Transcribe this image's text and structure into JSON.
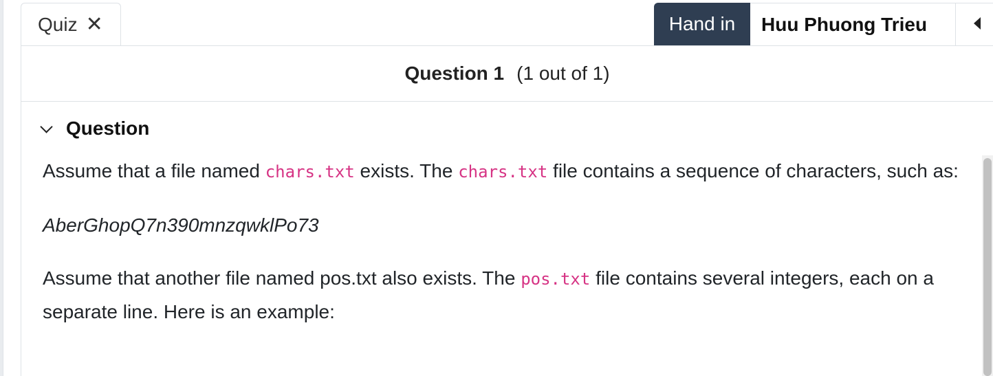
{
  "tabs": {
    "quiz_label": "Quiz",
    "close_glyph": "✕"
  },
  "toolbar": {
    "hand_in_label": "Hand in",
    "user_name": "Huu Phuong Trieu"
  },
  "question": {
    "title": "Question 1",
    "progress": "(1 out of 1)",
    "section_label": "Question"
  },
  "body": {
    "p1_pre": "Assume that a file named ",
    "p1_code1": "chars.txt",
    "p1_mid": " exists. The ",
    "p1_code2": "chars.txt",
    "p1_post": " file contains a sequence of characters, such as:",
    "sequence": "AberGhopQ7n390mnzqwklPo73",
    "p2_pre": "Assume that another file named pos.txt also exists. The ",
    "p2_code": "pos.txt",
    "p2_post": " file contains several integers, each on a separate line. Here is an example:"
  },
  "icons": {
    "close": "close-icon",
    "chevron": "chevron-down-icon",
    "collapse": "triangle-left-icon"
  },
  "colors": {
    "hand_in_bg": "#2f3e52",
    "code_text": "#d63384"
  }
}
